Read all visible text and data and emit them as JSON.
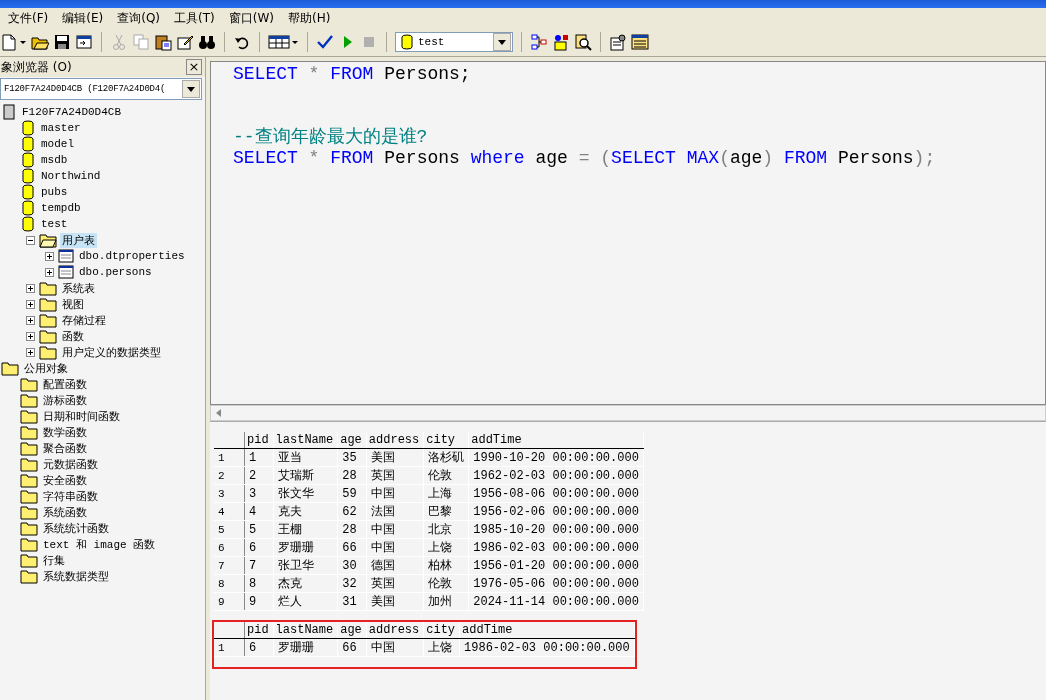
{
  "menu": [
    "文件(F)",
    "编辑(E)",
    "查询(Q)",
    "工具(T)",
    "窗口(W)",
    "帮助(H)"
  ],
  "toolbar": {
    "database": "test"
  },
  "object_browser": {
    "title": "象浏览器 (O)",
    "close": "×",
    "server_select": "F120F7A24D0D4CB (F120F7A24D0D4(",
    "tree": [
      {
        "label": "F120F7A24D0D4CB",
        "kind": "server",
        "children": [
          {
            "label": "master",
            "kind": "database"
          },
          {
            "label": "model",
            "kind": "database"
          },
          {
            "label": "msdb",
            "kind": "database"
          },
          {
            "label": "Northwind",
            "kind": "database"
          },
          {
            "label": "pubs",
            "kind": "database"
          },
          {
            "label": "tempdb",
            "kind": "database"
          },
          {
            "label": "test",
            "kind": "database",
            "children": [
              {
                "label": "用户表",
                "kind": "folder",
                "expanded": true,
                "selected": true,
                "children": [
                  {
                    "label": "dbo.dtproperties",
                    "kind": "table",
                    "expanded": false,
                    "selected": false
                  },
                  {
                    "label": "dbo.persons",
                    "kind": "table",
                    "expanded": false,
                    "selected": false
                  }
                ]
              },
              {
                "label": "系统表",
                "kind": "folder",
                "expanded": false,
                "selected": false
              },
              {
                "label": "视图",
                "kind": "folder",
                "expanded": false,
                "selected": false
              },
              {
                "label": "存储过程",
                "kind": "folder",
                "expanded": false,
                "selected": false
              },
              {
                "label": "函数",
                "kind": "folder",
                "expanded": false,
                "selected": false
              },
              {
                "label": "用户定义的数据类型",
                "kind": "folder",
                "expanded": false,
                "selected": false
              }
            ]
          }
        ]
      },
      {
        "label": "公用对象",
        "kind": "folder",
        "children": [
          {
            "label": "配置函数",
            "kind": "folder"
          },
          {
            "label": "游标函数",
            "kind": "folder"
          },
          {
            "label": "日期和时间函数",
            "kind": "folder"
          },
          {
            "label": "数学函数",
            "kind": "folder"
          },
          {
            "label": "聚合函数",
            "kind": "folder"
          },
          {
            "label": "元数据函数",
            "kind": "folder"
          },
          {
            "label": "安全函数",
            "kind": "folder"
          },
          {
            "label": "字符串函数",
            "kind": "folder"
          },
          {
            "label": "系统函数",
            "kind": "folder"
          },
          {
            "label": "系统统计函数",
            "kind": "folder"
          },
          {
            "label": "text 和 image 函数",
            "kind": "folder"
          },
          {
            "label": "行集",
            "kind": "folder"
          },
          {
            "label": "系统数据类型",
            "kind": "folder"
          }
        ]
      }
    ]
  },
  "editor": {
    "lines": [
      {
        "tokens": [
          {
            "text": "SELECT",
            "kind": "keyword"
          },
          {
            "text": " * ",
            "kind": "operator"
          },
          {
            "text": "FROM",
            "kind": "keyword"
          },
          {
            "text": " Persons;",
            "kind": "plain"
          }
        ]
      },
      {
        "blank_before": true,
        "tokens": [
          {
            "text": "--查询年龄最大的是谁?",
            "kind": "comment"
          }
        ]
      },
      {
        "tokens": [
          {
            "text": "SELECT",
            "kind": "keyword"
          },
          {
            "text": " * ",
            "kind": "operator"
          },
          {
            "text": "FROM",
            "kind": "keyword"
          },
          {
            "text": " Persons ",
            "kind": "plain"
          },
          {
            "text": "where",
            "kind": "keyword"
          },
          {
            "text": " age ",
            "kind": "plain"
          },
          {
            "text": "= (",
            "kind": "operator"
          },
          {
            "text": "SELECT MAX",
            "kind": "keyword"
          },
          {
            "text": "(",
            "kind": "operator"
          },
          {
            "text": "age",
            "kind": "plain"
          },
          {
            "text": ") ",
            "kind": "operator"
          },
          {
            "text": "FROM",
            "kind": "keyword"
          },
          {
            "text": " Persons",
            "kind": "plain"
          },
          {
            "text": ");",
            "kind": "operator"
          }
        ]
      }
    ]
  },
  "results": [
    {
      "highlighted": false,
      "columns": [
        "pid",
        "lastName",
        "age",
        "address",
        "city",
        "addTime"
      ],
      "rows": [
        {
          "n": "1",
          "cells": [
            "1",
            "亚当",
            "35",
            "美国",
            "洛杉矶",
            "1990-10-20 00:00:00.000"
          ]
        },
        {
          "n": "2",
          "cells": [
            "2",
            "艾瑞斯",
            "28",
            "英国",
            "伦敦",
            "1962-02-03 00:00:00.000"
          ]
        },
        {
          "n": "3",
          "cells": [
            "3",
            "张文华",
            "59",
            "中国",
            "上海",
            "1956-08-06 00:00:00.000"
          ]
        },
        {
          "n": "4",
          "cells": [
            "4",
            "克夫",
            "62",
            "法国",
            "巴黎",
            "1956-02-06 00:00:00.000"
          ]
        },
        {
          "n": "5",
          "cells": [
            "5",
            "王棚",
            "28",
            "中国",
            "北京",
            "1985-10-20 00:00:00.000"
          ]
        },
        {
          "n": "6",
          "cells": [
            "6",
            "罗珊珊",
            "66",
            "中国",
            "上饶",
            "1986-02-03 00:00:00.000"
          ]
        },
        {
          "n": "7",
          "cells": [
            "7",
            "张卫华",
            "30",
            "德国",
            "柏林",
            "1956-01-20 00:00:00.000"
          ]
        },
        {
          "n": "8",
          "cells": [
            "8",
            "杰克",
            "32",
            "英国",
            "伦敦",
            "1976-05-06 00:00:00.000"
          ]
        },
        {
          "n": "9",
          "cells": [
            "9",
            "烂人",
            "31",
            "美国",
            "加州",
            "2024-11-14 00:00:00.000"
          ]
        }
      ]
    },
    {
      "highlighted": true,
      "columns": [
        "pid",
        "lastName",
        "age",
        "address",
        "city",
        "addTime"
      ],
      "rows": [
        {
          "n": "1",
          "cells": [
            "6",
            "罗珊珊",
            "66",
            "中国",
            "上饶",
            "1986-02-03 00:00:00.000"
          ]
        }
      ]
    }
  ]
}
